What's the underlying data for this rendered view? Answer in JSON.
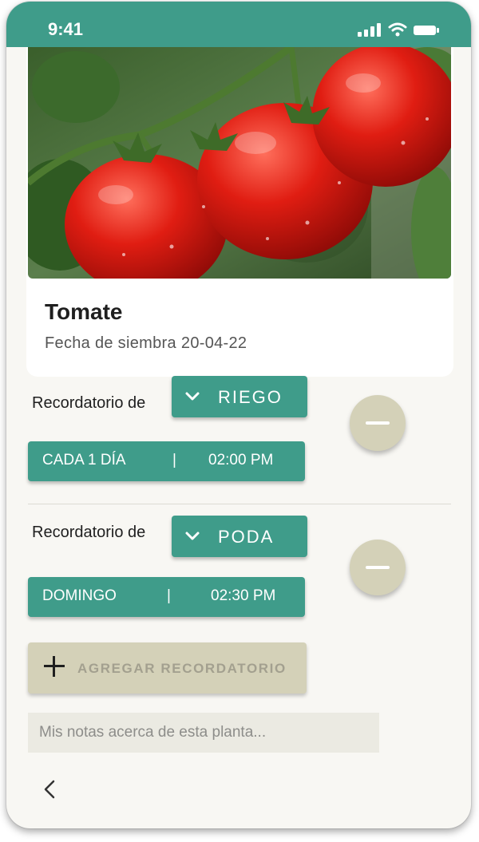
{
  "status_bar": {
    "time": "9:41"
  },
  "plant": {
    "name": "Tomate",
    "sow_date_label": "Fecha de siembra",
    "sow_date_value": "20-04-22"
  },
  "reminders": [
    {
      "label": "Recordatorio de",
      "type": "RIEGO",
      "frequency": "CADA 1 DÍA",
      "separator": "|",
      "time": "02:00 PM"
    },
    {
      "label": "Recordatorio de",
      "type": "PODA",
      "frequency": "DOMINGO",
      "separator": "|",
      "time": "02:30 PM"
    }
  ],
  "add_button": {
    "label": "AGREGAR RECORDATORIO"
  },
  "notes": {
    "placeholder": "Mis notas acerca de esta planta..."
  },
  "colors": {
    "primary": "#3f9c8a",
    "secondary": "#d4d1b8",
    "background": "#f8f7f3"
  },
  "icons": [
    "signal-icon",
    "wifi-icon",
    "battery-icon",
    "chevron-down-icon",
    "minus-icon",
    "plus-icon",
    "back-chevron-icon"
  ]
}
